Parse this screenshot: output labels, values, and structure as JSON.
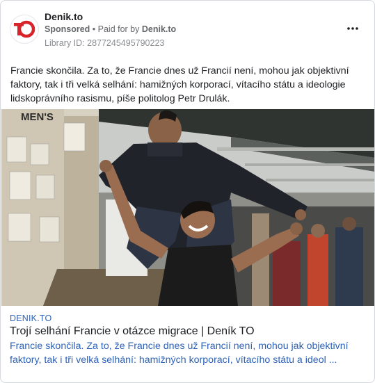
{
  "header": {
    "page_name": "Denik.to",
    "sponsored_label": "Sponsored",
    "paid_for_prefix": "• Paid for by",
    "advertiser": "Denik.to",
    "library_id": "Library ID: 2877245495790223",
    "avatar_logo_text": "TO",
    "more_icon": "more-horizontal-icon"
  },
  "post": {
    "text": "Francie skončila. Za to, že Francie dnes už Francií není, mohou jak objektivní faktory, tak i tři velká selhání: hamižných korporací, vítacího státu a ideologie lidskoprávního rasismu, píše politolog Petr Drulák."
  },
  "media": {
    "sign_text": "MEN'S"
  },
  "link_preview": {
    "domain": "DENIK.TO",
    "title": "Trojí selhání Francie v otázce migrace | Deník TO",
    "description": "Francie skončila. Za to, že Francie dnes už Francií není, mohou jak objektivní faktory, tak i tři velká selhání: hamižných korporací, vítacího státu a ideol ..."
  },
  "colors": {
    "brand_red": "#d8232a",
    "link_blue": "#2d63b8",
    "meta_gray": "#65676b"
  }
}
